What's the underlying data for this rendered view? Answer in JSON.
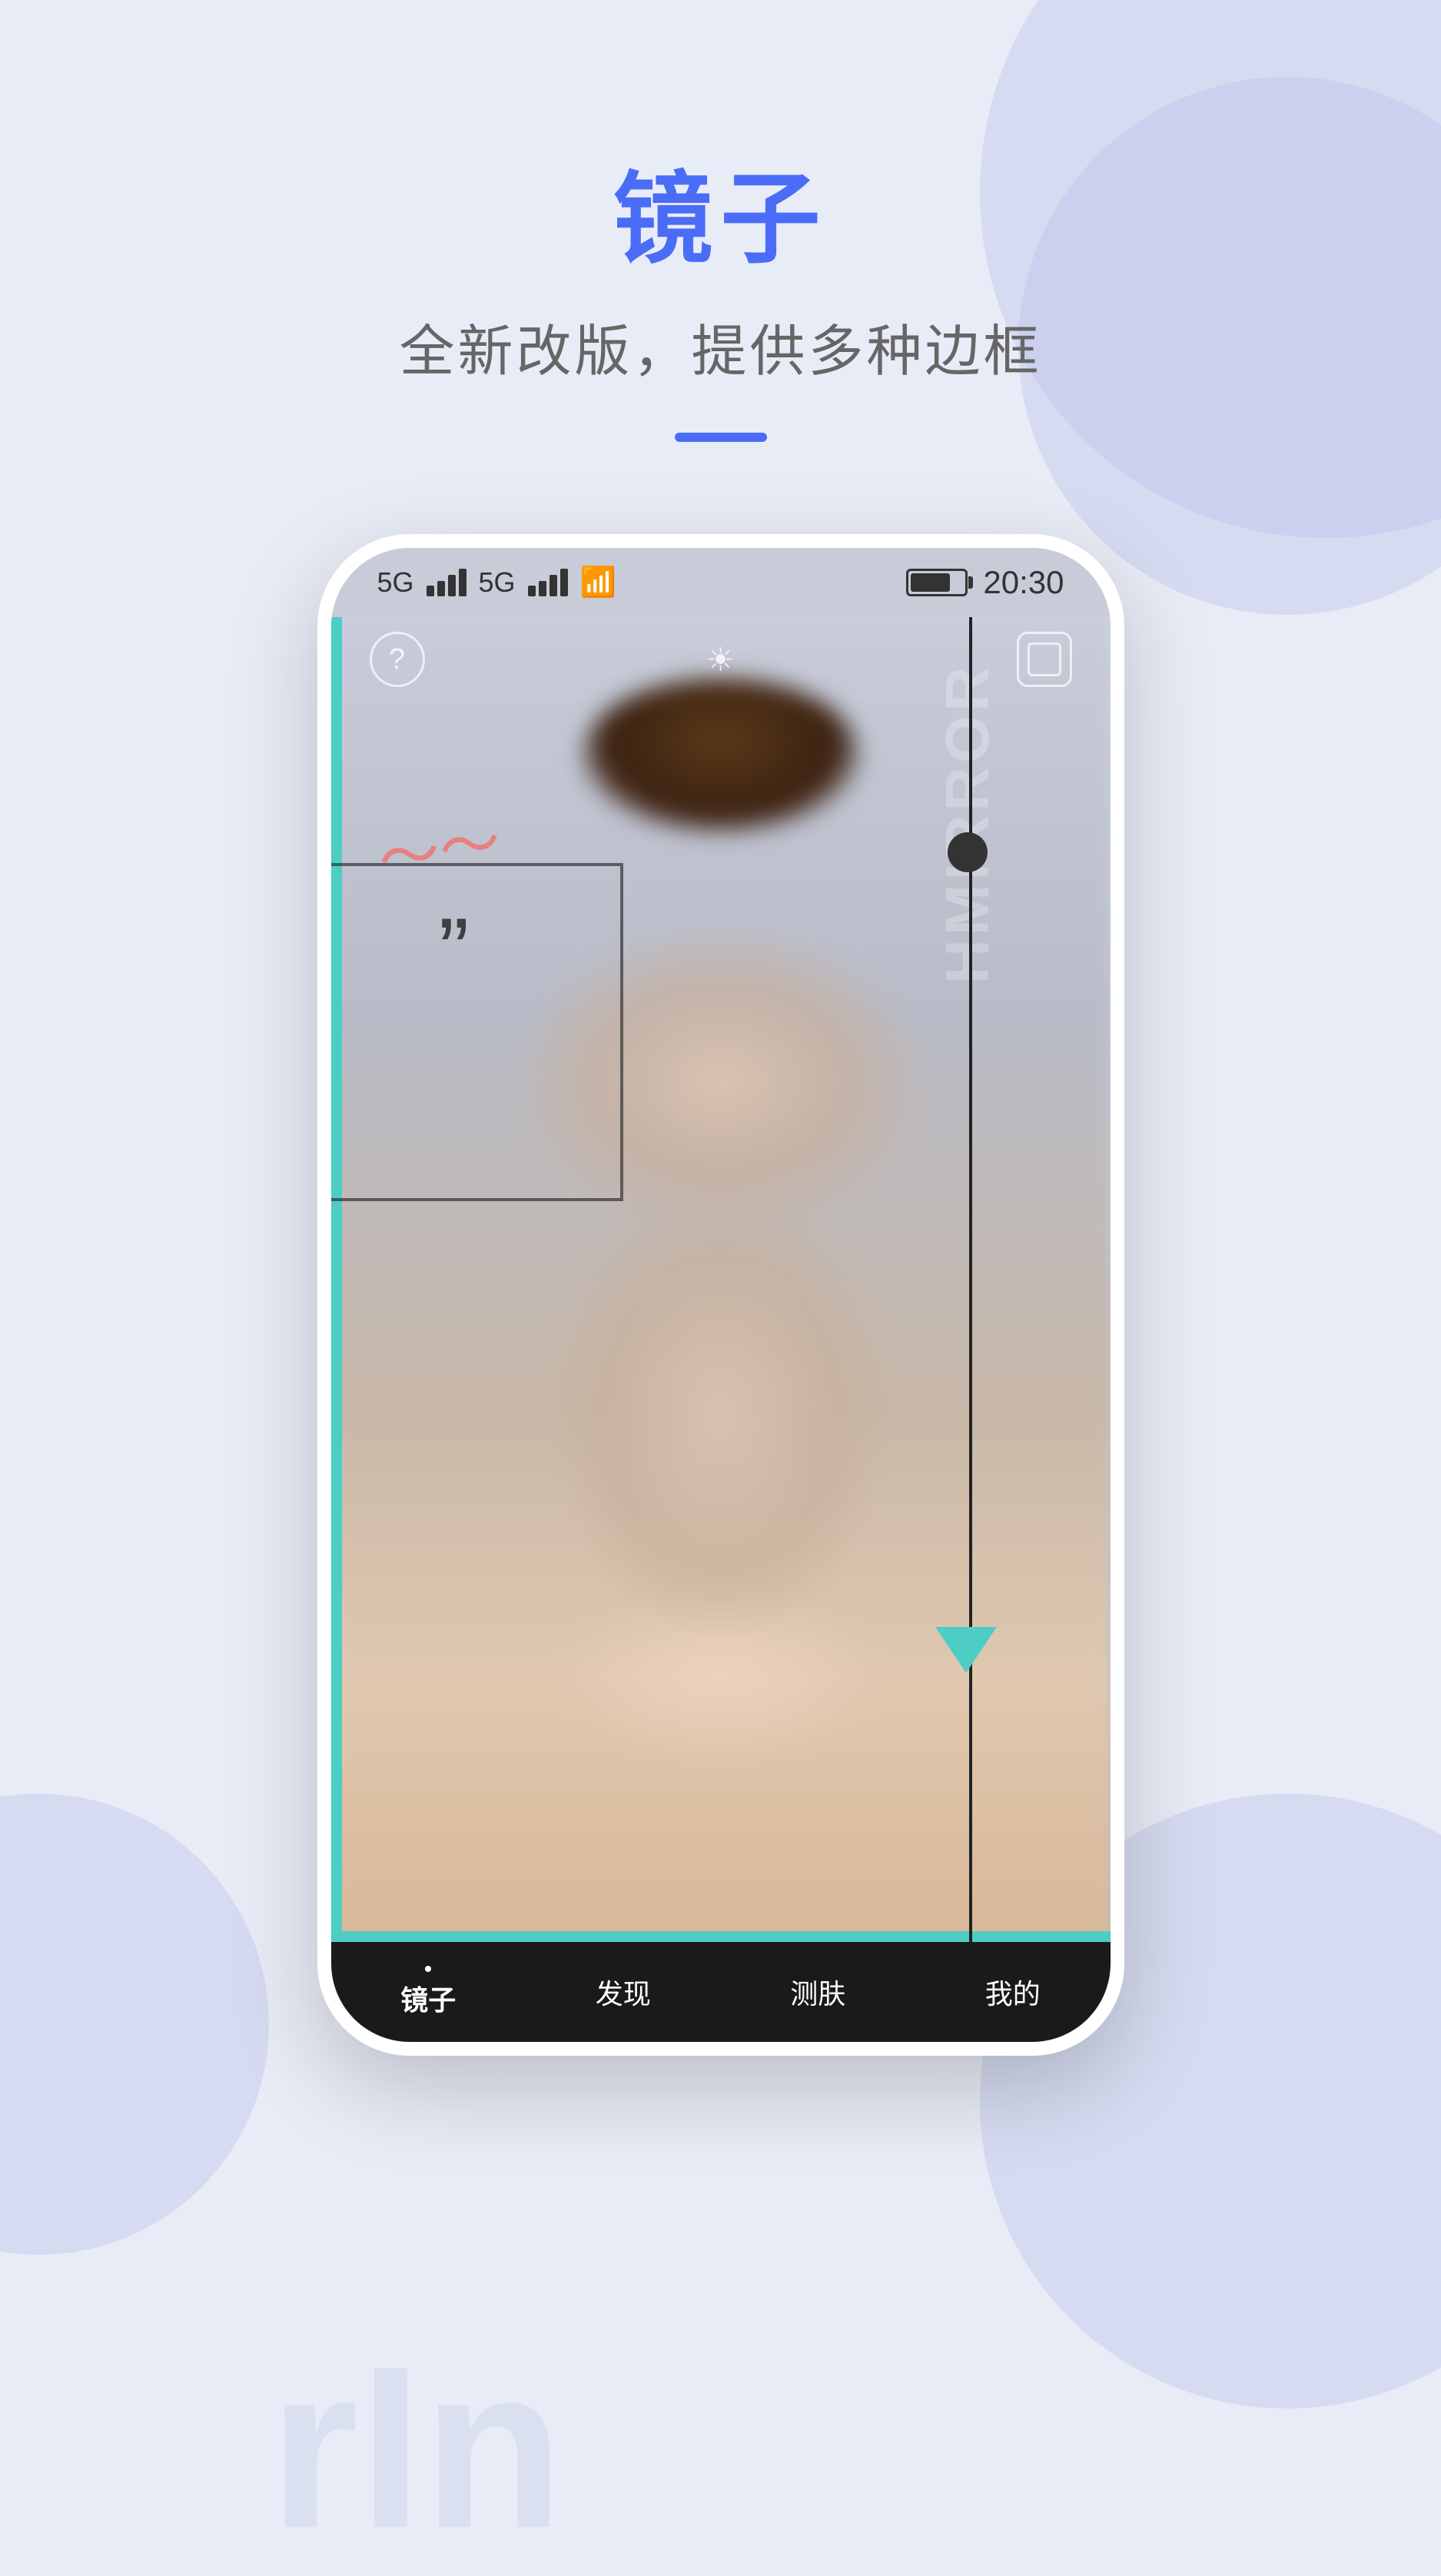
{
  "page": {
    "title": "镜子",
    "subtitle": "全新改版，提供多种边框",
    "bg_color": "#e8ecf7"
  },
  "status_bar": {
    "network1": "5G",
    "network2": "5G",
    "time": "20:30"
  },
  "toolbar": {
    "help_icon": "?",
    "brightness_icon": "☀",
    "frame_icon": "⊡"
  },
  "mirror": {
    "watermark": "HMIRROR",
    "quote_top": "”",
    "quote_bottom": "„"
  },
  "tabs": [
    {
      "label": "镜子",
      "active": true
    },
    {
      "label": "发现",
      "active": false
    },
    {
      "label": "测肤",
      "active": false
    },
    {
      "label": "我的",
      "active": false
    }
  ],
  "watermark": {
    "text": "rIn"
  }
}
